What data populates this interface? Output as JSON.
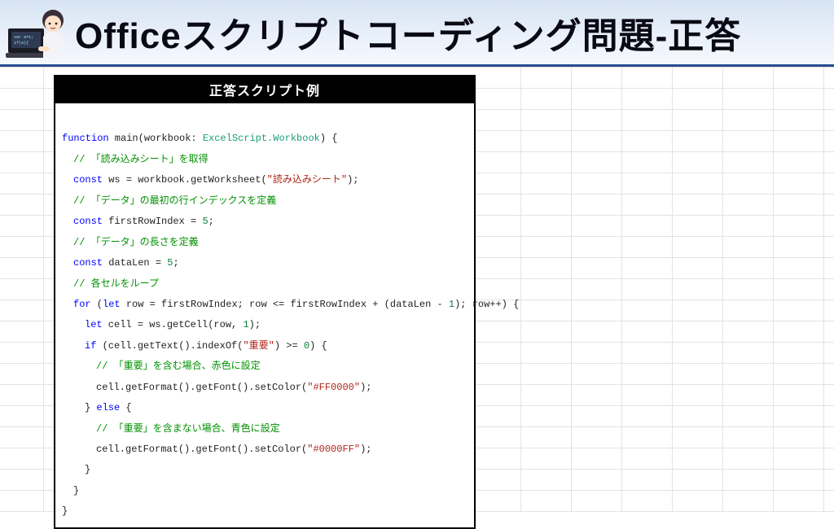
{
  "header": {
    "title": "Officeスクリプトコーディング問題-正答"
  },
  "card": {
    "title": "正答スクリプト例"
  },
  "code": {
    "kw_function": "function",
    "fn_main": " main(workbook: ",
    "ty_ws": "ExcelScript.Workbook",
    "fn_main_tail": ") {",
    "cm_getSheet": "// 「読み込みシート」を取得",
    "kw_const1": "const",
    "ln_ws": " ws = workbook.getWorksheet(",
    "st_sheet": "\"読み込みシート\"",
    "ln_ws_tail": ");",
    "cm_firstRow": "// 「データ」の最初の行インデックスを定義",
    "kw_const2": "const",
    "ln_firstRow": " firstRowIndex = ",
    "nm_five_a": "5",
    "semi": ";",
    "cm_dataLen": "// 「データ」の長さを定義",
    "kw_const3": "const",
    "ln_dataLen": " dataLen = ",
    "nm_five_b": "5",
    "cm_loop": "// 各セルをループ",
    "kw_for": "for",
    "for_open": " (",
    "kw_let1": "let",
    "for_body": " row = firstRowIndex; row <= firstRowIndex + (dataLen - ",
    "nm_one_a": "1",
    "for_tail": "); row++) {",
    "kw_let2": "let",
    "ln_cell": " cell = ws.getCell(row, ",
    "nm_one_b": "1",
    "ln_cell_tail": ");",
    "kw_if": "if",
    "if_open": " (cell.getText().indexOf(",
    "st_important": "\"重要\"",
    "if_mid": ") >= ",
    "nm_zero": "0",
    "if_tail": ") {",
    "cm_red": "// 「重要」を含む場合、赤色に設定",
    "ln_setRed_a": "cell.getFormat().getFont().setColor(",
    "st_red": "\"#FF0000\"",
    "ln_setColor_tail": ");",
    "else_line_a": "} ",
    "kw_else": "else",
    "else_line_b": " {",
    "cm_blue": "// 「重要」を含まない場合、青色に設定",
    "ln_setBlue_a": "cell.getFormat().getFont().setColor(",
    "st_blue": "\"#0000FF\"",
    "close_brace": "}",
    "close_brace2": "}",
    "close_brace3": "}"
  }
}
